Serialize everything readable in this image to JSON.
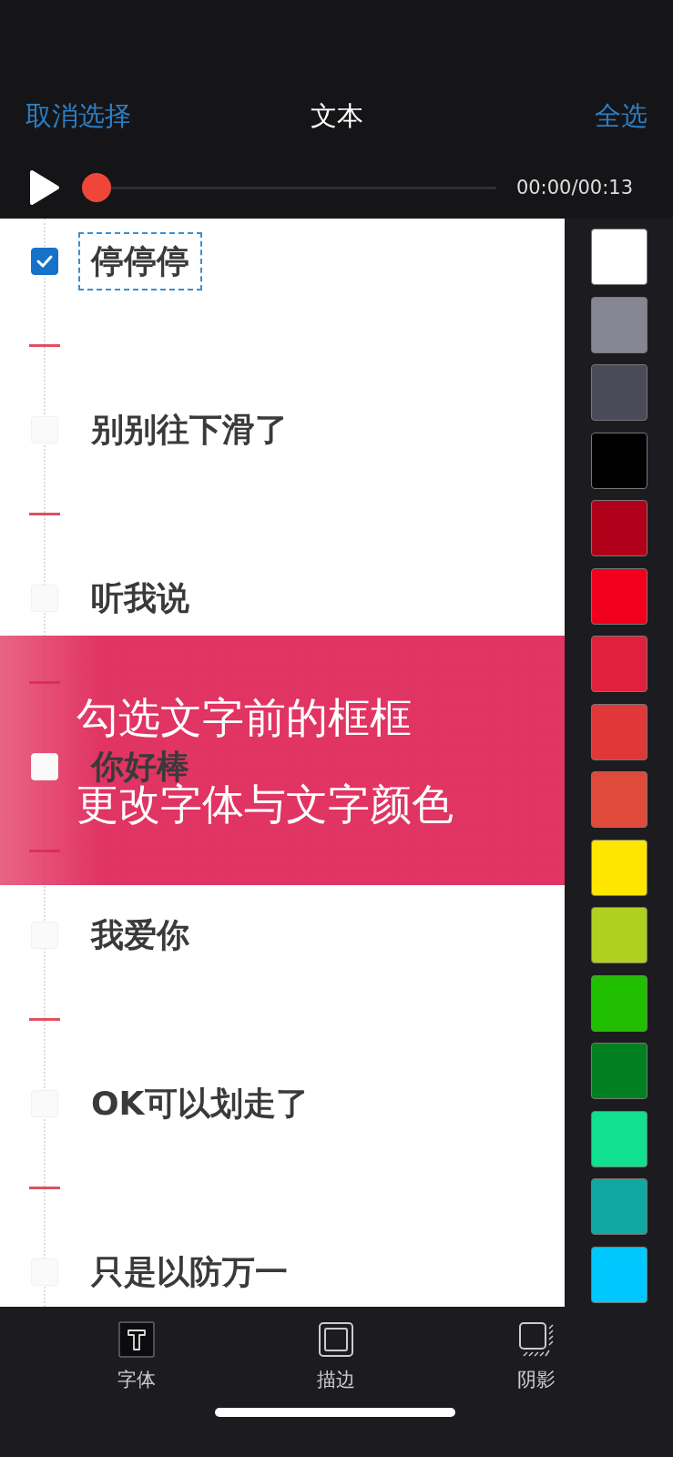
{
  "nav": {
    "left": "取消选择",
    "title": "文本",
    "right": "全选"
  },
  "player": {
    "level": 0,
    "time": "00:00/00:13"
  },
  "lines": [
    {
      "text": "停停停",
      "checked": true
    },
    {
      "text": "别别往下滑了",
      "checked": false
    },
    {
      "text": "听我说",
      "checked": false
    },
    {
      "text": "你好棒",
      "checked": false
    },
    {
      "text": "我爱你",
      "checked": false
    },
    {
      "text": "OK可以划走了",
      "checked": false
    },
    {
      "text": "只是以防万一",
      "checked": false
    }
  ],
  "swatches": [
    {
      "color": "#ffffff"
    },
    {
      "color": "#868692"
    },
    {
      "color": "#4a4a58"
    },
    {
      "color": "#000000"
    },
    {
      "color": "#b0001a"
    },
    {
      "color": "#f0001c"
    },
    {
      "color": "#e0203c"
    },
    {
      "color": "#e03838"
    },
    {
      "color": "#e04a3a"
    },
    {
      "color": "#ffe600"
    },
    {
      "color": "#b0d020"
    },
    {
      "color": "#20c000"
    },
    {
      "color": "#008020"
    },
    {
      "color": "#10e090"
    },
    {
      "color": "#10a8a0"
    },
    {
      "color": "#00c8ff"
    }
  ],
  "banner": {
    "lines": [
      "勾选文字前的框框",
      "更改字体与文字颜色"
    ]
  },
  "tabs": [
    {
      "kind": "font",
      "label": "字体"
    },
    {
      "kind": "stroke",
      "label": "描边"
    },
    {
      "kind": "shadow",
      "label": "阴影"
    }
  ]
}
